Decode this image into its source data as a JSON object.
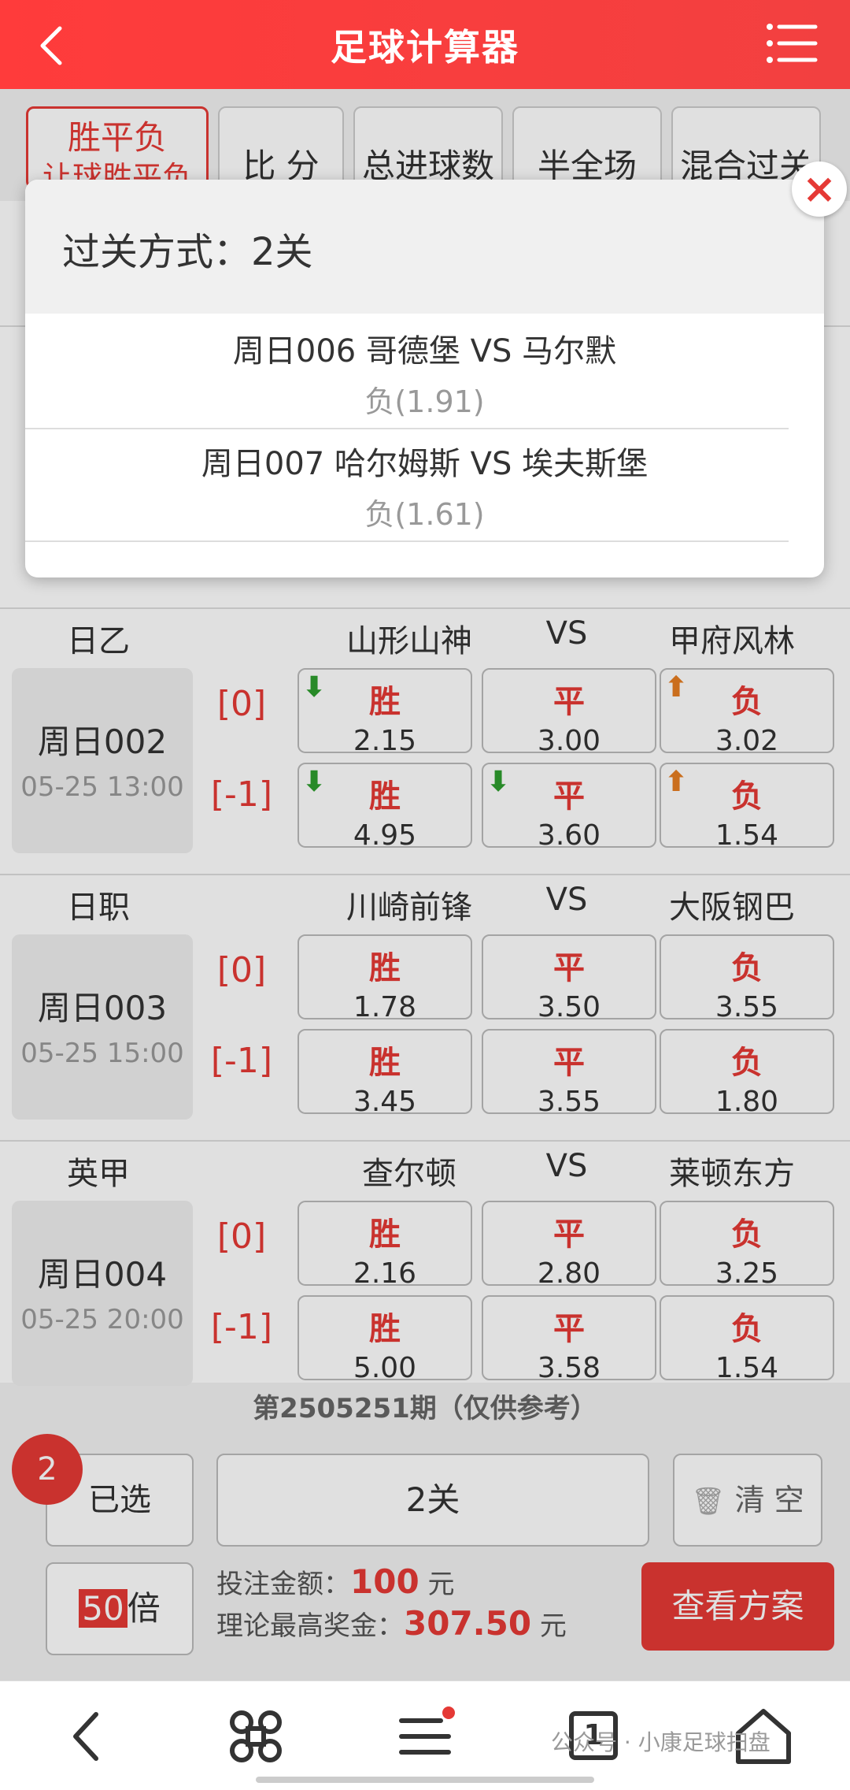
{
  "header": {
    "title": "足球计算器"
  },
  "tabs": [
    {
      "label": "胜平负",
      "sub": "让球胜平负"
    },
    {
      "label": "比 分"
    },
    {
      "label": "总进球数"
    },
    {
      "label": "半全场"
    },
    {
      "label": "混合过关"
    }
  ],
  "matches": [
    {
      "league": "日乙",
      "home": "山形山神",
      "vs": "VS",
      "away": "甲府风林",
      "id": "周日002",
      "time": "05-25 13:00",
      "rows": [
        {
          "hc": "[0]",
          "odds": [
            {
              "label": "胜",
              "value": "2.15",
              "arrow": "down"
            },
            {
              "label": "平",
              "value": "3.00",
              "arrow": ""
            },
            {
              "label": "负",
              "value": "3.02",
              "arrow": "up"
            }
          ]
        },
        {
          "hc": "[-1]",
          "odds": [
            {
              "label": "胜",
              "value": "4.95",
              "arrow": "down"
            },
            {
              "label": "平",
              "value": "3.60",
              "arrow": "down"
            },
            {
              "label": "负",
              "value": "1.54",
              "arrow": "up"
            }
          ]
        }
      ]
    },
    {
      "league": "日职",
      "home": "川崎前锋",
      "vs": "VS",
      "away": "大阪钢巴",
      "id": "周日003",
      "time": "05-25 15:00",
      "rows": [
        {
          "hc": "[0]",
          "odds": [
            {
              "label": "胜",
              "value": "1.78"
            },
            {
              "label": "平",
              "value": "3.50"
            },
            {
              "label": "负",
              "value": "3.55"
            }
          ]
        },
        {
          "hc": "[-1]",
          "odds": [
            {
              "label": "胜",
              "value": "3.45"
            },
            {
              "label": "平",
              "value": "3.55"
            },
            {
              "label": "负",
              "value": "1.80"
            }
          ]
        }
      ]
    },
    {
      "league": "英甲",
      "home": "查尔顿",
      "vs": "VS",
      "away": "莱顿东方",
      "id": "周日004",
      "time": "05-25 20:00",
      "rows": [
        {
          "hc": "[0]",
          "odds": [
            {
              "label": "胜",
              "value": "2.16"
            },
            {
              "label": "平",
              "value": "2.80"
            },
            {
              "label": "负",
              "value": "3.25"
            }
          ]
        },
        {
          "hc": "[-1]",
          "odds": [
            {
              "label": "胜",
              "value": "5.00"
            },
            {
              "label": "平",
              "value": "3.58"
            },
            {
              "label": "负",
              "value": "1.54"
            }
          ]
        }
      ]
    }
  ],
  "issue": "第2505251期（仅供参考）",
  "selected": {
    "count": "2",
    "label": "已选"
  },
  "pass": "2关",
  "clear": "清 空",
  "multiple": {
    "value": "50",
    "unit": "倍"
  },
  "bet": {
    "amount_label": "投注金额：",
    "amount": "100",
    "amount_unit": " 元",
    "max_label": "理论最高奖金：",
    "max": "307.50",
    "max_unit": " 元"
  },
  "view_plan": "查看方案",
  "modal": {
    "title": "过关方式：2关",
    "items": [
      {
        "teams": "周日006 哥德堡 VS 马尔默",
        "pick": "负(1.91)"
      },
      {
        "teams": "周日007 哈尔姆斯 VS 埃夫斯堡",
        "pick": "负(1.61)"
      }
    ],
    "close": "×"
  },
  "bottom_nav": {
    "tab_count": "1"
  },
  "watermark": "公众号 · 小康足球扫盘",
  "colors": {
    "accent": "#e53935",
    "header": "#f24040",
    "arrow_down": "#2e9e2e",
    "arrow_up": "#e67e22"
  }
}
